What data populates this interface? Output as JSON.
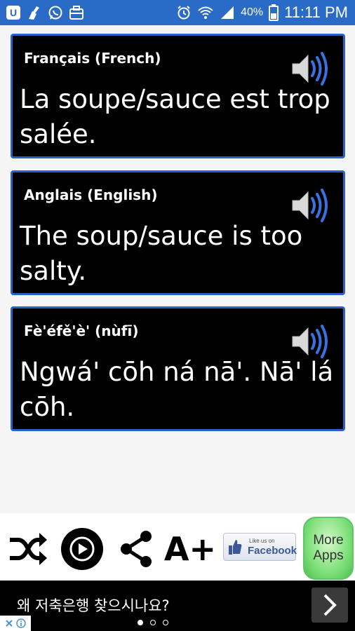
{
  "status_bar": {
    "battery": "40%",
    "time": "11:11 PM",
    "icons_left": [
      "app-icon",
      "broom-icon",
      "whatsapp-icon",
      "briefcase-icon"
    ],
    "icons_right": [
      "alarm-icon",
      "wifi-icon",
      "signal-icon",
      "battery-icon"
    ]
  },
  "cards": [
    {
      "language": "Français (French)",
      "phrase": "La soupe/sauce est trop salée."
    },
    {
      "language": "Anglais (English)",
      "phrase": "The soup/sauce is too salty."
    },
    {
      "language": "Fè'éfě'è' (nùfī)",
      "phrase": "Ngwá' cōh ná nā'. Nā' lá cōh."
    }
  ],
  "toolbar": {
    "items": [
      "shuffle-icon",
      "play-icon",
      "share-icon",
      "font-size-icon"
    ],
    "font_label": "A+",
    "facebook_small": "Like us on",
    "facebook_big": "Facebook",
    "more_apps_line1": "More",
    "more_apps_line2": "Apps"
  },
  "ad": {
    "text": "왜 저축은행 찾으시나요?"
  },
  "colors": {
    "status_bar": "#2a6bc7",
    "card_border": "#2a63c7",
    "more_apps": "#7fe07a"
  }
}
